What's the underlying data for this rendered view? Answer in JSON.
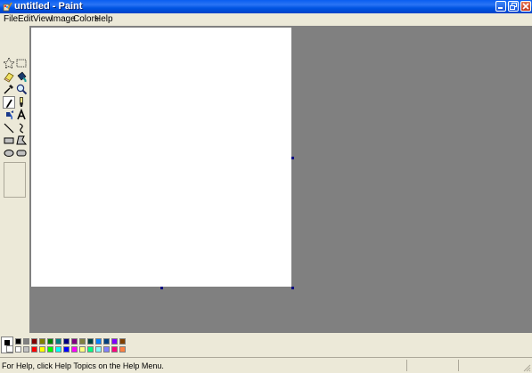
{
  "window": {
    "title": "untitled - Paint",
    "buttons": [
      "minimize",
      "maximize",
      "close"
    ]
  },
  "menu": {
    "items": [
      "File",
      "Edit",
      "View",
      "Image",
      "Colors",
      "Help"
    ]
  },
  "toolbox": {
    "tools": [
      {
        "name": "free-form-select",
        "icon": "star-select-icon"
      },
      {
        "name": "select",
        "icon": "rect-select-icon"
      },
      {
        "name": "eraser",
        "icon": "eraser-icon"
      },
      {
        "name": "fill-with-color",
        "icon": "paint-bucket-icon"
      },
      {
        "name": "pick-color",
        "icon": "eyedropper-icon"
      },
      {
        "name": "magnifier",
        "icon": "magnifier-icon"
      },
      {
        "name": "pencil",
        "icon": "pencil-icon",
        "selected": true
      },
      {
        "name": "brush",
        "icon": "brush-icon"
      },
      {
        "name": "airbrush",
        "icon": "airbrush-icon"
      },
      {
        "name": "text",
        "icon": "text-icon"
      },
      {
        "name": "line",
        "icon": "line-icon"
      },
      {
        "name": "curve",
        "icon": "curve-icon"
      },
      {
        "name": "rectangle",
        "icon": "rectangle-icon"
      },
      {
        "name": "polygon",
        "icon": "polygon-icon"
      },
      {
        "name": "ellipse",
        "icon": "ellipse-icon"
      },
      {
        "name": "rounded-rectangle",
        "icon": "rounded-rectangle-icon"
      }
    ]
  },
  "palette": {
    "foreground": "#000000",
    "background": "#ffffff",
    "top_row": [
      "#000000",
      "#808080",
      "#800000",
      "#808000",
      "#008000",
      "#008080",
      "#000080",
      "#800080",
      "#808040",
      "#004040",
      "#0080ff",
      "#004080",
      "#8000ff",
      "#804000"
    ],
    "bottom_row": [
      "#ffffff",
      "#c0c0c0",
      "#ff0000",
      "#ffff00",
      "#00ff00",
      "#00ffff",
      "#0000ff",
      "#ff00ff",
      "#ffff80",
      "#00ff80",
      "#80ffff",
      "#8080ff",
      "#ff0080",
      "#ff8040"
    ]
  },
  "statusbar": {
    "text": "For Help, click Help Topics on the Help Menu."
  },
  "colors": {
    "titlebar": "#0054e3",
    "workspace": "#808080",
    "canvas": "#ffffff",
    "chrome": "#ece9d8"
  }
}
